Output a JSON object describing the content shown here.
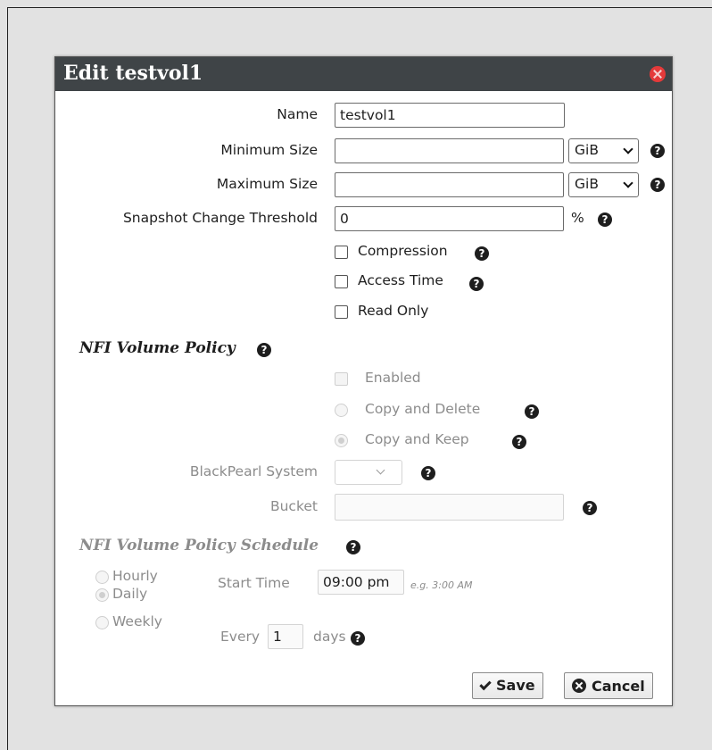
{
  "dialog": {
    "title": "Edit testvol1",
    "close_icon": "close-circle-icon",
    "help_icon": "question-circle-icon",
    "colors": {
      "titlebar": "#3f4447",
      "close": "#e43a3a",
      "disabled_text": "#8c8c8c"
    }
  },
  "form": {
    "name_label": "Name",
    "name_value": "testvol1",
    "min_size_label": "Minimum Size",
    "min_size_value": "",
    "min_size_unit": "GiB",
    "max_size_label": "Maximum Size",
    "max_size_value": "",
    "max_size_unit": "GiB",
    "snapshot_label": "Snapshot Change Threshold",
    "snapshot_value": "0",
    "snapshot_unit": "%",
    "compression_label": "Compression",
    "compression_checked": false,
    "access_time_label": "Access Time",
    "access_time_checked": false,
    "read_only_label": "Read Only",
    "read_only_checked": false
  },
  "nfi_policy": {
    "heading": "NFI Volume Policy",
    "enabled_label": "Enabled",
    "copy_delete_label": "Copy and Delete",
    "copy_keep_label": "Copy and Keep",
    "selected_mode": "Copy and Keep",
    "blackpearl_label": "BlackPearl System",
    "blackpearl_value": "",
    "bucket_label": "Bucket",
    "bucket_value": ""
  },
  "schedule": {
    "heading": "NFI Volume Policy Schedule",
    "hourly_label": "Hourly",
    "daily_label": "Daily",
    "weekly_label": "Weekly",
    "selected": "Daily",
    "start_time_label": "Start Time",
    "start_time_value": "09:00 pm",
    "start_time_hint": "e.g. 3:00 AM",
    "every_label": "Every",
    "every_value": "1",
    "days_label": "days"
  },
  "buttons": {
    "save_label": "Save",
    "cancel_label": "Cancel"
  }
}
